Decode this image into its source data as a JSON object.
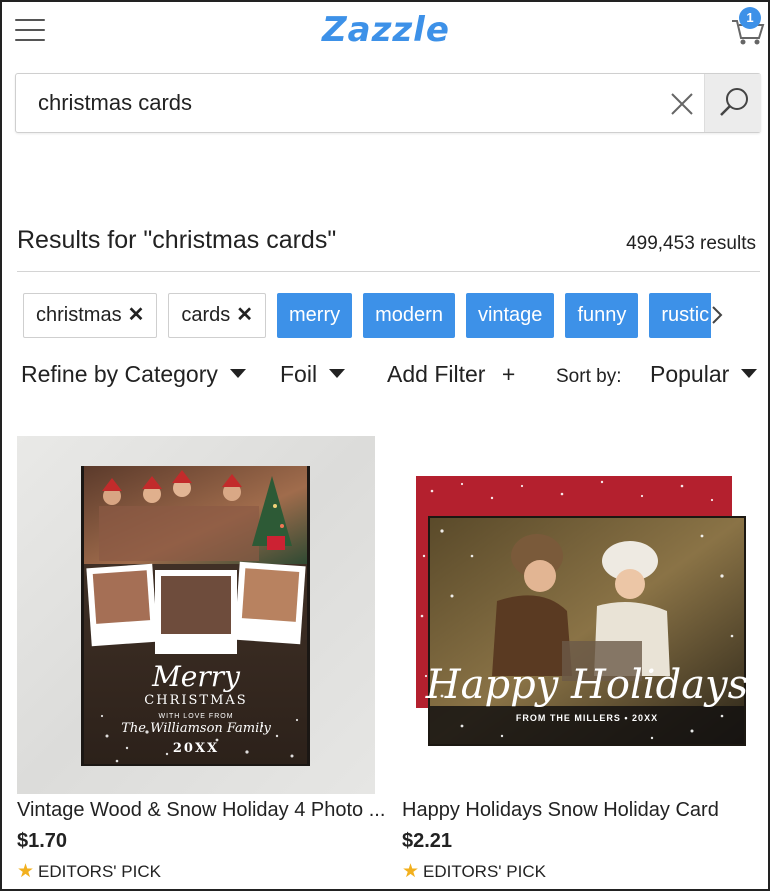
{
  "header": {
    "logo": "Zazzle",
    "cart_count": "1",
    "brand_color": "#3d91e8"
  },
  "search": {
    "value": "christmas cards"
  },
  "results": {
    "title": "Results for \"christmas cards\"",
    "count": "499,453 results"
  },
  "chips": {
    "removable": [
      {
        "label": "christmas",
        "remove": "✕"
      },
      {
        "label": "cards",
        "remove": "✕"
      }
    ],
    "suggestions": [
      "merry",
      "modern",
      "vintage",
      "funny",
      "rustic"
    ]
  },
  "filters": {
    "category": "Refine by Category",
    "foil": "Foil",
    "add_filter": "Add Filter",
    "add_symbol": "+",
    "sort_label": "Sort by:",
    "sort_value": "Popular"
  },
  "products": [
    {
      "title": "Vintage Wood & Snow Holiday 4 Photo ...",
      "price": "$1.70",
      "badge": "EDITORS' PICK",
      "card_text": {
        "merry": "Merry",
        "christmas": "CHRISTMAS",
        "with_love": "WITH LOVE FROM",
        "family": "The Williamson Family",
        "year": "20XX"
      }
    },
    {
      "title": "Happy Holidays Snow Holiday Card",
      "price": "$2.21",
      "badge": "EDITORS' PICK",
      "card_text": {
        "greeting": "Happy Holidays",
        "from": "FROM THE MILLERS • 20XX"
      }
    }
  ]
}
